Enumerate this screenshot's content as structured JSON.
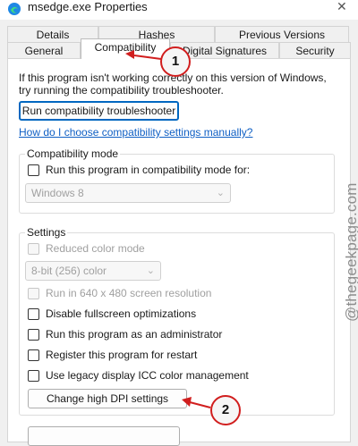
{
  "window": {
    "title": "msedge.exe Properties",
    "close_glyph": "✕"
  },
  "tabs": {
    "details": "Details",
    "hashes": "Hashes",
    "previous_versions": "Previous Versions",
    "general": "General",
    "compatibility": "Compatibility",
    "digital_signatures": "Digital Signatures",
    "security": "Security"
  },
  "intro": {
    "line1": "If this program isn't working correctly on this version of Windows,",
    "line2": "try running the compatibility troubleshooter."
  },
  "troubleshooter_button": "Run compatibility troubleshooter",
  "help_link": "How do I choose compatibility settings manually?",
  "compat_mode": {
    "label": "Compatibility mode",
    "checkbox_label": "Run this program in compatibility mode for:",
    "os_value": "Windows 8"
  },
  "settings": {
    "label": "Settings",
    "reduced_color": "Reduced color mode",
    "color_value": "8-bit (256) color",
    "resolution": "Run in 640 x 480 screen resolution",
    "fullscreen_opt": "Disable fullscreen optimizations",
    "admin": "Run this program as an administrator",
    "restart": "Register this program for restart",
    "icc": "Use legacy display ICC color management",
    "dpi_button": "Change high DPI settings"
  },
  "callouts": {
    "step1": "1",
    "step2": "2"
  },
  "watermark": "@thegeekpage.com",
  "colors": {
    "accent": "#0067c0",
    "callout_border": "#d11e1e",
    "link": "#0f5fc4"
  }
}
